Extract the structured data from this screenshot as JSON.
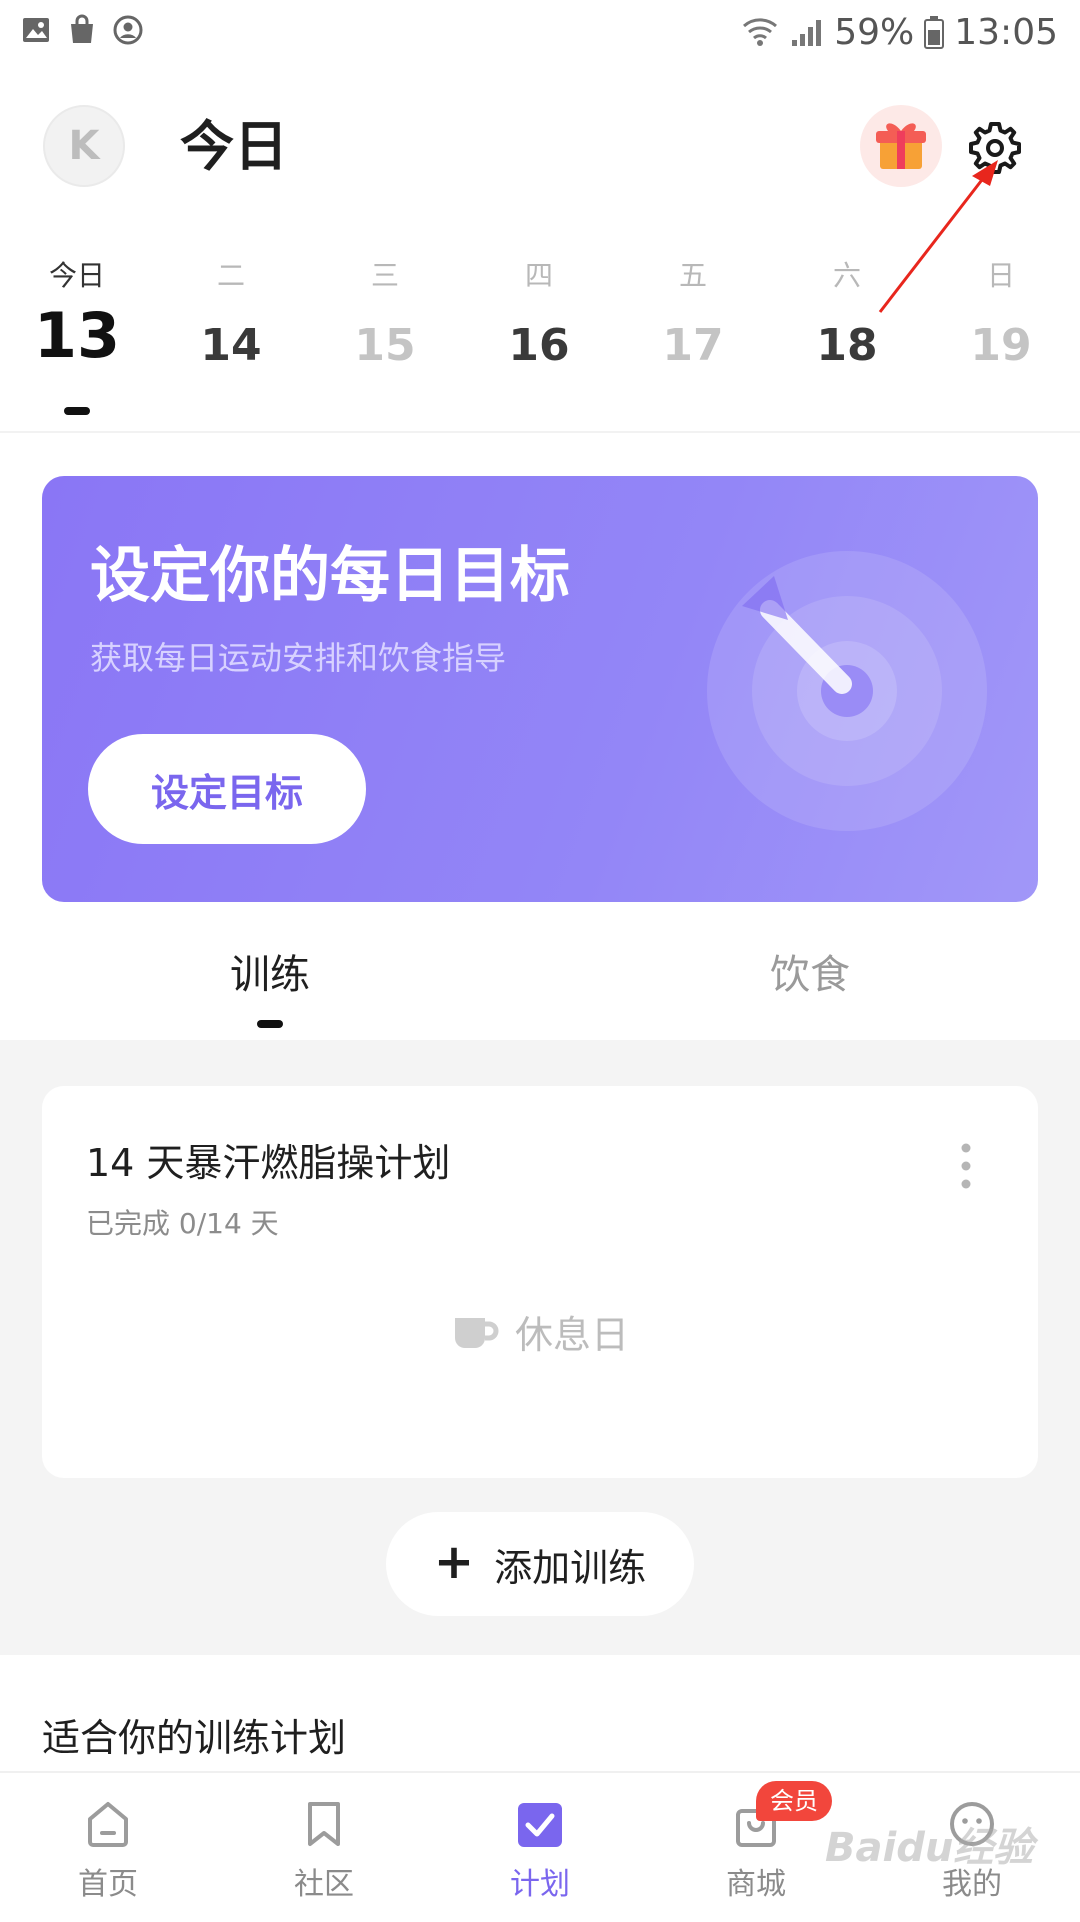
{
  "status_bar": {
    "battery": "59%",
    "time": "13:05",
    "icons": [
      "gallery-icon",
      "shopping-bag-icon",
      "account-circle-icon",
      "wifi-icon",
      "signal-icon",
      "battery-icon"
    ]
  },
  "header": {
    "avatar_initial": "K",
    "title": "今日",
    "icons": [
      "gift-icon",
      "gear-icon"
    ]
  },
  "week": {
    "days": [
      {
        "weekday": "今日",
        "date": "13",
        "state": "today"
      },
      {
        "weekday": "二",
        "date": "14",
        "state": "dark"
      },
      {
        "weekday": "三",
        "date": "15",
        "state": "light"
      },
      {
        "weekday": "四",
        "date": "16",
        "state": "dark"
      },
      {
        "weekday": "五",
        "date": "17",
        "state": "light"
      },
      {
        "weekday": "六",
        "date": "18",
        "state": "dark"
      },
      {
        "weekday": "日",
        "date": "19",
        "state": "light"
      }
    ]
  },
  "banner": {
    "title": "设定你的每日目标",
    "subtitle": "获取每日运动安排和饮食指导",
    "button": "设定目标",
    "art_icon": "target-icon"
  },
  "tabs": {
    "training": "训练",
    "diet": "饮食",
    "active": "training"
  },
  "plan_card": {
    "title": "14 天暴汗燃脂操计划",
    "progress": "已完成 0/14 天",
    "rest": "休息日",
    "rest_icon": "coffee-cup-icon",
    "more_icon": "more-vertical-icon"
  },
  "add_training": {
    "label": "添加训练",
    "icon": "plus-icon"
  },
  "recommend": {
    "title": "适合你的训练计划"
  },
  "bottom_nav": {
    "items": [
      {
        "label": "首页",
        "icon": "home-icon"
      },
      {
        "label": "社区",
        "icon": "bookmark-icon"
      },
      {
        "label": "计划",
        "icon": "check-box-icon",
        "active": true
      },
      {
        "label": "商城",
        "icon": "shopping-bag-icon",
        "badge": "会员"
      },
      {
        "label": "我的",
        "icon": "face-icon"
      }
    ]
  },
  "watermark": "Baidu经验",
  "colors": {
    "accent": "#7a66ee",
    "banner": "#8f80f6",
    "badge": "#f2463c",
    "annotation_arrow": "#e8261d"
  }
}
